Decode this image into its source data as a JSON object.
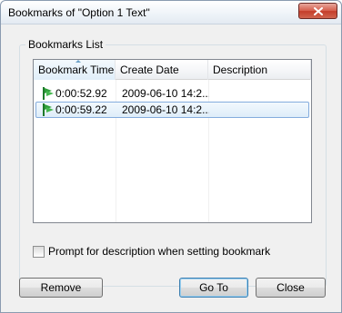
{
  "window": {
    "title": "Bookmarks of \"Option 1 Text\""
  },
  "group": {
    "label": "Bookmarks List"
  },
  "list": {
    "columns": [
      "Bookmark Time",
      "Create Date",
      "Description"
    ],
    "sorted_column": "Bookmark Time",
    "rows": [
      {
        "time": "0:00:52.92",
        "date": "2009-06-10 14:2...",
        "description": "",
        "selected": false
      },
      {
        "time": "0:00:59.22",
        "date": "2009-06-10 14:2...",
        "description": "",
        "selected": true
      }
    ],
    "row_icon": "bookmark-flag-icon"
  },
  "prompt": {
    "label": "Prompt for description when setting bookmark",
    "checked": false
  },
  "buttons": {
    "remove": "Remove",
    "goto": "Go To",
    "close": "Close"
  },
  "colors": {
    "accent": "#3c7fb1",
    "close_button": "#d55d4b",
    "bookmark_icon": "#2f9e3a",
    "selection": "#deedf9"
  }
}
